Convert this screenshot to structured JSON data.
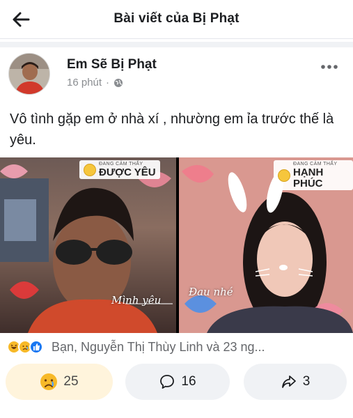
{
  "header": {
    "title": "Bài viết của Bị Phạt",
    "back_icon": "arrow-left-icon"
  },
  "post": {
    "author": "Em Sẽ Bị Phạt",
    "time": "16 phút",
    "separator": "·",
    "privacy_icon": "globe-icon",
    "more_icon": "more-horizontal-icon",
    "caption": "Vô tình gặp em ở nhà xí , nhường em ỉa trước thế là yêu."
  },
  "photos": {
    "left": {
      "sticker_small": "ĐANG CẢM THẤY",
      "sticker_main": "ĐƯỢC YÊU",
      "script_text": "Mình yêu"
    },
    "right": {
      "sticker_small": "ĐANG CẢM THẤY",
      "sticker_main": "HẠNH PHÚC",
      "script_text": "Đau nhé"
    }
  },
  "reactions": {
    "icons": [
      "haha-icon",
      "sad-icon",
      "like-icon"
    ],
    "summary": "Bạn, Nguyễn Thị Thùy Linh và 23 ng..."
  },
  "actions": {
    "react_count": "25",
    "react_icon": "sad-face-icon",
    "comment_count": "16",
    "comment_icon": "comment-icon",
    "share_count": "3",
    "share_icon": "share-icon"
  },
  "colors": {
    "text": "#1c1e21",
    "muted": "#65676b",
    "like_blue": "#1877f2",
    "reaction_yellow": "#f7b928",
    "react_button_bg": "#fff4dc",
    "button_bg": "#f0f2f5"
  }
}
